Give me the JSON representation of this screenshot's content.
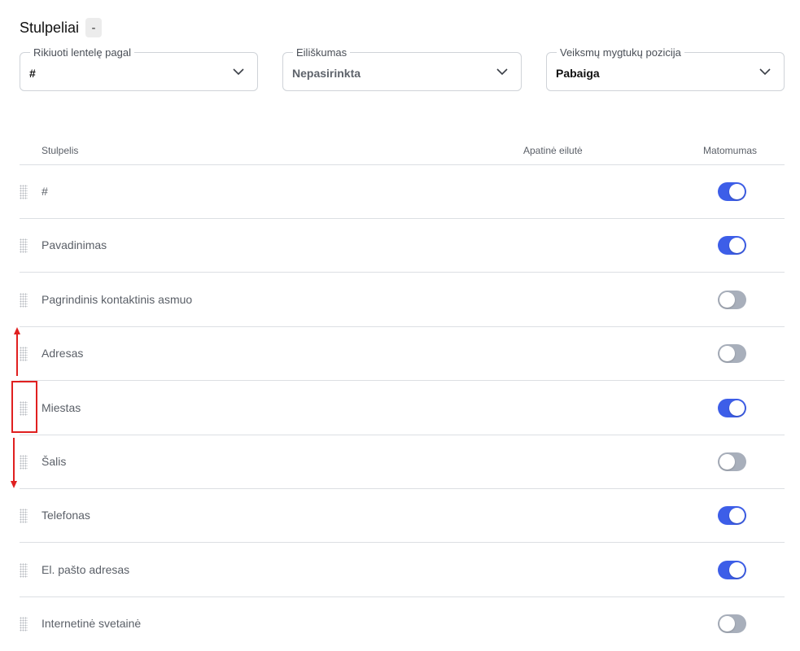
{
  "section": {
    "title": "Stulpeliai",
    "collapse_label": "-"
  },
  "fields": {
    "sort": {
      "legend": "Rikiuoti lentelę pagal",
      "value": "#"
    },
    "order": {
      "legend": "Eiliškumas",
      "value": "Nepasirinkta"
    },
    "actions": {
      "legend": "Veiksmų mygtukų pozicija",
      "value": "Pabaiga"
    }
  },
  "table": {
    "headers": {
      "column": "Stulpelis",
      "bottom_row": "Apatinė eilutė",
      "visibility": "Matomumas"
    },
    "rows": [
      {
        "label": "#",
        "visible": true
      },
      {
        "label": "Pavadinimas",
        "visible": true
      },
      {
        "label": "Pagrindinis kontaktinis asmuo",
        "visible": false
      },
      {
        "label": "Adresas",
        "visible": false
      },
      {
        "label": "Miestas",
        "visible": true
      },
      {
        "label": "Šalis",
        "visible": false
      },
      {
        "label": "Telefonas",
        "visible": true
      },
      {
        "label": "El. pašto adresas",
        "visible": true
      },
      {
        "label": "Internetinė svetainė",
        "visible": false
      }
    ]
  },
  "colors": {
    "toggle_on": "#3d5ee8",
    "toggle_off": "#a8afbb",
    "annotation": "#e02020"
  },
  "icons": {
    "field_chevron": "chevron-down-icon",
    "row_handle": "drag-handle-icon"
  }
}
